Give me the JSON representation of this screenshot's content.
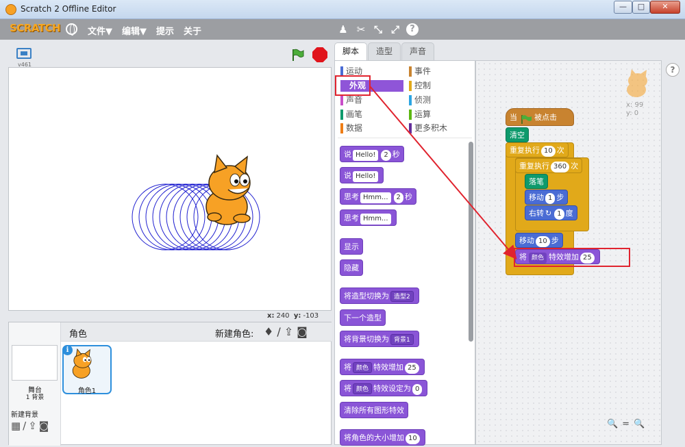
{
  "window": {
    "title": "Scratch 2 Offline Editor",
    "min": "—",
    "max": "□",
    "close": "✕"
  },
  "menubar": {
    "logo": "SCRATCH",
    "items": [
      "文件▼",
      "编辑▼",
      "提示",
      "关于"
    ],
    "tools": [
      "♟",
      "✂",
      "⤡",
      "⤢",
      "?"
    ]
  },
  "stage": {
    "version": "v461",
    "coords_x_label": "x:",
    "coords_x": "240",
    "coords_y_label": "y:",
    "coords_y": "-103"
  },
  "sprites": {
    "title": "角色",
    "new_sprite_label": "新建角色:",
    "new_sprite_icons": "♦/⇪◙",
    "stage_name": "舞台",
    "stage_bg_count": "1 背景",
    "new_bg_label": "新建背景",
    "new_bg_icons": "▦/⇪◙",
    "sprite1_name": "角色1",
    "info": "i"
  },
  "tabs": [
    "脚本",
    "造型",
    "声音"
  ],
  "categories": {
    "motion": "运动",
    "looks": "外观",
    "sound": "声音",
    "pen": "画笔",
    "data": "数据",
    "events": "事件",
    "control": "控制",
    "sensing": "侦测",
    "operators": "运算",
    "more": "更多积木"
  },
  "colors": {
    "looks": "#8a55d7",
    "motion": "#4a6cd4",
    "control": "#e1a91a",
    "events": "#c88330",
    "pen": "#0e9a6c",
    "highlight": "#e0232e"
  },
  "palette_blocks": {
    "say_secs": {
      "say": "说",
      "text": "Hello!",
      "num": "2",
      "secs": "秒"
    },
    "say": {
      "say": "说",
      "text": "Hello!"
    },
    "think_secs": {
      "label": "思考",
      "text": "Hmm...",
      "num": "2",
      "secs": "秒"
    },
    "think": {
      "label": "思考",
      "text": "Hmm..."
    },
    "show": "显示",
    "hide": "隐藏",
    "switch_costume": {
      "label": "将造型切换为",
      "value": "造型2"
    },
    "next_costume": "下一个造型",
    "switch_backdrop": {
      "label": "将背景切换为",
      "value": "背景1"
    },
    "change_effect": {
      "pre": "将",
      "effect": "颜色",
      "label": "特效增加",
      "num": "25"
    },
    "set_effect": {
      "pre": "将",
      "effect": "颜色",
      "label": "特效设定为",
      "num": "0"
    },
    "clear_effects": "清除所有图形特效",
    "change_size": {
      "label": "将角色的大小增加",
      "num": "10"
    }
  },
  "script": {
    "when_flag": {
      "pre": "当",
      "post": "被点击"
    },
    "clear": "清空",
    "repeat_outer": {
      "label": "重复执行",
      "num": "10",
      "unit": "次"
    },
    "repeat_inner": {
      "label": "重复执行",
      "num": "360",
      "unit": "次"
    },
    "pen_down": "落笔",
    "move1": {
      "label": "移动",
      "num": "1",
      "unit": "步"
    },
    "turn": {
      "label": "右转",
      "num": "1",
      "unit": "度"
    },
    "move10": {
      "label": "移动",
      "num": "10",
      "unit": "步"
    },
    "change_effect": {
      "pre": "将",
      "effect": "颜色",
      "label": "特效增加",
      "num": "25"
    }
  },
  "script_sprite": {
    "x": "x: 99",
    "y": "y: 0"
  },
  "zoom": "🔍=🔍",
  "help": "?"
}
